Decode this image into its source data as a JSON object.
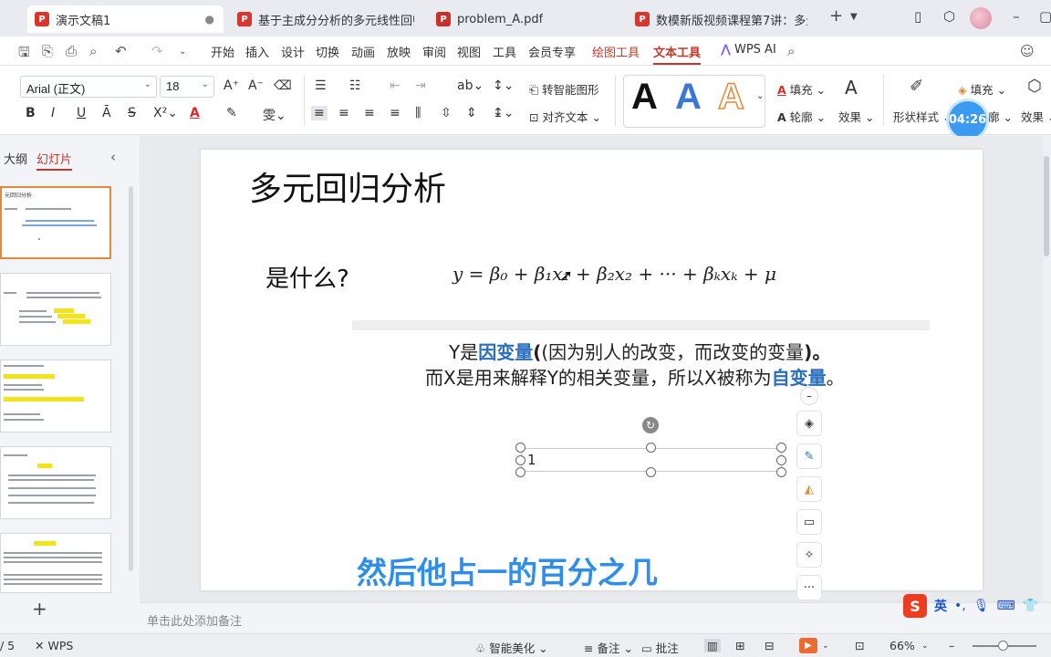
{
  "tabs": [
    {
      "label": "演示文稿1",
      "active": true,
      "icon": "ppt-icon"
    },
    {
      "label": "基于主成分分析的多元线性回归",
      "icon": "ppt-icon"
    },
    {
      "label": "problem_A.pdf",
      "icon": "pdf-icon"
    },
    {
      "label": "数模新版视频课程第7讲：多元线",
      "icon": "ppt-icon"
    }
  ],
  "menus": [
    "开始",
    "插入",
    "设计",
    "切换",
    "动画",
    "放映",
    "审阅",
    "视图",
    "工具",
    "会员专享",
    "绘图工具",
    "文本工具",
    "WPS AI"
  ],
  "ribbon": {
    "font_name": "Arial (正文)",
    "font_size": "18",
    "convert_smartart": "转智能图形",
    "align_text": "对齐文本",
    "fill": "填充",
    "outline": "轮廓",
    "effect": "效果",
    "shape_style": "形状样式",
    "fill2": "填充",
    "outline2_partial": "廓",
    "effect2": "效果",
    "art_letter": "A",
    "colors": {
      "black": "#111111",
      "blue": "#3a78d4",
      "orange": "#e8873a"
    }
  },
  "timer": "04:26",
  "left_panel": {
    "outline_tab": "大纲",
    "slides_tab": "幻灯片"
  },
  "slide": {
    "title": "多元回归分析",
    "question": "是什么?",
    "formula": "y = β₀ + β₁x₁ + β₂x₂ + ··· + βₖxₖ + μ",
    "line1_a": "Y是",
    "line1_hi": "因变量",
    "line1_b": "(因为别人的改变，而改变的变量",
    "line1_c": ")。",
    "line2_a": "而X是用来解释Y的相关变量，所以X被称为",
    "line2_hi": "自变量",
    "line2_b": "。",
    "textbox_value": "1",
    "subtitle": "然后他占一的百分之几"
  },
  "notes_placeholder": "单击此处添加备注",
  "status": {
    "slide_count_partial": "/ 5",
    "app": "WPS",
    "beautify": "智能美化",
    "notes": "备注",
    "comments": "批注",
    "zoom": "66%"
  },
  "ime": {
    "mode": "英"
  }
}
